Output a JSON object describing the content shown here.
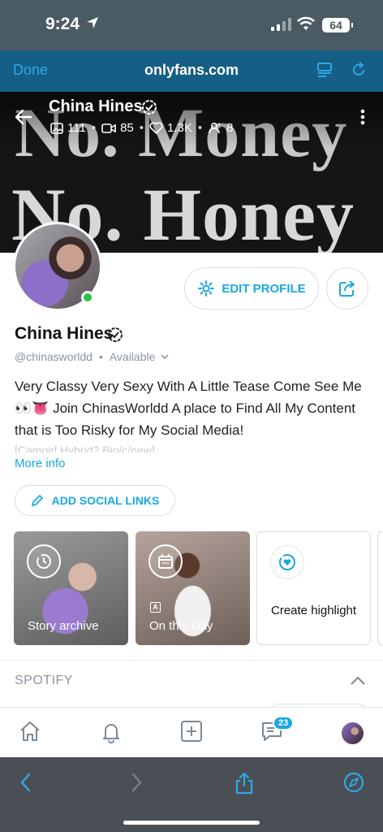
{
  "status_bar": {
    "time": "9:24",
    "battery": "64"
  },
  "browser": {
    "done_label": "Done",
    "url": "onlyfans.com"
  },
  "cover": {
    "line1": "No. Money",
    "line2": "No. Honey",
    "display_name": "China Hines",
    "stats": {
      "photos": "111",
      "videos": "85",
      "likes": "1.3K",
      "fans": "8"
    }
  },
  "profile": {
    "edit_label": "EDIT PROFILE",
    "name": "China Hines",
    "handle": "@chinasworldd",
    "availability": "Available",
    "bio_line1": "Very Classy Very Sexy With A Little Tease Come See Me",
    "bio_emoji": "👀👅",
    "bio_line2": " Join ChinasWorldd A place to Find All My Content",
    "bio_line3": "that is Too Risky for My Social Media!",
    "bio_fade": "[Camgirl Hybrid? Bio/c/new]",
    "more_info": "More info",
    "social_label": "ADD SOCIAL LINKS"
  },
  "highlights": [
    {
      "label": "Story archive"
    },
    {
      "label": "On this Day"
    },
    {
      "label": "Create highlight"
    }
  ],
  "spotify": {
    "title": "SPOTIFY"
  },
  "tabbar": {
    "messages_badge": "23"
  },
  "colors": {
    "accent": "#1aa7e0",
    "browser_bar": "#155e85",
    "online": "#28c445"
  }
}
